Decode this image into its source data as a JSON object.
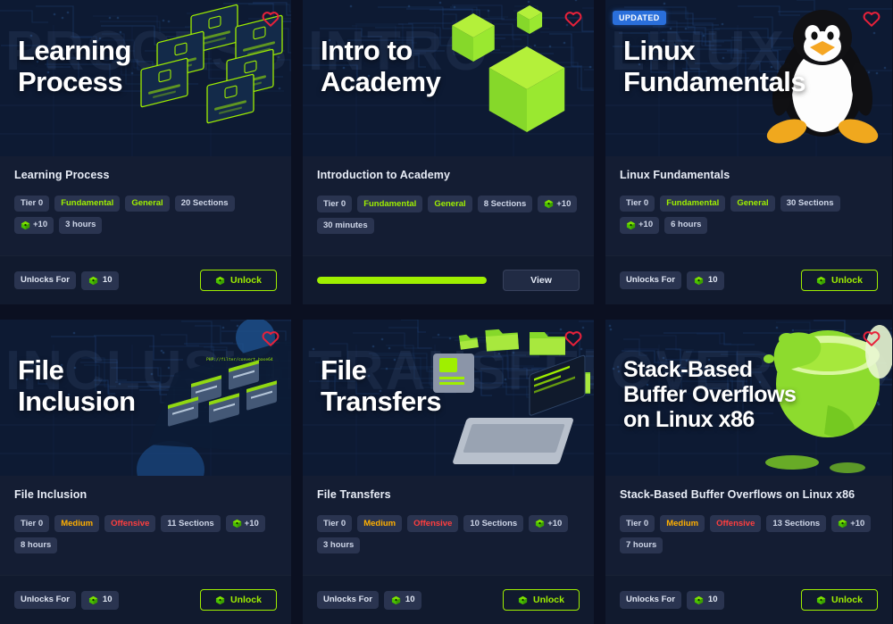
{
  "cards": [
    {
      "hero_title": "Learning\nProcess",
      "ghost": "PROCESS",
      "name": "Learning Process",
      "tags": [
        {
          "label": "Tier 0",
          "style": "default"
        },
        {
          "label": "Fundamental",
          "style": "green"
        },
        {
          "label": "General",
          "style": "green"
        },
        {
          "label": "20 Sections",
          "style": "default"
        },
        {
          "label": "+10",
          "style": "cube"
        },
        {
          "label": "3 hours",
          "style": "default"
        }
      ],
      "favorite_icon": "heart-icon",
      "footer": {
        "type": "unlock",
        "unlocks_for_label": "Unlocks For",
        "cost": "10",
        "button_label": "Unlock"
      },
      "art": "learning-process-nodes"
    },
    {
      "hero_title": "Intro to\nAcademy",
      "ghost": "INTRO",
      "name": "Introduction to Academy",
      "tags": [
        {
          "label": "Tier 0",
          "style": "default"
        },
        {
          "label": "Fundamental",
          "style": "green"
        },
        {
          "label": "General",
          "style": "green"
        },
        {
          "label": "8 Sections",
          "style": "default"
        },
        {
          "label": "+10",
          "style": "cube"
        },
        {
          "label": "30 minutes",
          "style": "default"
        }
      ],
      "favorite_icon": "heart-icon",
      "footer": {
        "type": "progress",
        "progress_percent": 100,
        "button_label": "View"
      },
      "art": "green-cubes"
    },
    {
      "badge": "UPDATED",
      "hero_title": "Linux\nFundamentals",
      "ghost": "LINUX",
      "name": "Linux Fundamentals",
      "tags": [
        {
          "label": "Tier 0",
          "style": "default"
        },
        {
          "label": "Fundamental",
          "style": "green"
        },
        {
          "label": "General",
          "style": "green"
        },
        {
          "label": "30 Sections",
          "style": "default"
        },
        {
          "label": "+10",
          "style": "cube"
        },
        {
          "label": "6 hours",
          "style": "default"
        }
      ],
      "favorite_icon": "heart-icon",
      "footer": {
        "type": "unlock",
        "unlocks_for_label": "Unlocks For",
        "cost": "10",
        "button_label": "Unlock"
      },
      "art": "tux-penguin"
    },
    {
      "hero_title": "File\nInclusion",
      "ghost": "INCLUSION",
      "name": "File Inclusion",
      "tags": [
        {
          "label": "Tier 0",
          "style": "default"
        },
        {
          "label": "Medium",
          "style": "orange"
        },
        {
          "label": "Offensive",
          "style": "red"
        },
        {
          "label": "11 Sections",
          "style": "default"
        },
        {
          "label": "+10",
          "style": "cube"
        },
        {
          "label": "8 hours",
          "style": "default"
        }
      ],
      "favorite_icon": "heart-icon",
      "footer": {
        "type": "unlock",
        "unlocks_for_label": "Unlocks For",
        "cost": "10",
        "button_label": "Unlock"
      },
      "art": "file-inclusion-diagram"
    },
    {
      "hero_title": "File\nTransfers",
      "ghost": "TRANSFER",
      "name": "File Transfers",
      "tags": [
        {
          "label": "Tier 0",
          "style": "default"
        },
        {
          "label": "Medium",
          "style": "orange"
        },
        {
          "label": "Offensive",
          "style": "red"
        },
        {
          "label": "10 Sections",
          "style": "default"
        },
        {
          "label": "+10",
          "style": "cube"
        },
        {
          "label": "3 hours",
          "style": "default"
        }
      ],
      "favorite_icon": "heart-icon",
      "footer": {
        "type": "unlock",
        "unlocks_for_label": "Unlocks For",
        "cost": "10",
        "button_label": "Unlock"
      },
      "art": "folders-laptop"
    },
    {
      "hero_title": "Stack-Based\nBuffer Overflows\non Linux x86",
      "ghost": "OVERFLOW",
      "name": "Stack-Based Buffer Overflows on Linux x86",
      "tags": [
        {
          "label": "Tier 0",
          "style": "default"
        },
        {
          "label": "Medium",
          "style": "orange"
        },
        {
          "label": "Offensive",
          "style": "red"
        },
        {
          "label": "13 Sections",
          "style": "default"
        },
        {
          "label": "+10",
          "style": "cube"
        },
        {
          "label": "7 hours",
          "style": "default"
        }
      ],
      "favorite_icon": "heart-icon",
      "footer": {
        "type": "unlock",
        "unlocks_for_label": "Unlocks For",
        "cost": "10",
        "button_label": "Unlock"
      },
      "art": "overflowing-cup"
    }
  ],
  "colors": {
    "accent_green": "#9fef00",
    "warning_orange": "#ffaf00",
    "danger_red": "#ff3e3e",
    "badge_blue": "#2a6fdb",
    "heart_red": "#e8213a",
    "card_bg": "#141d33",
    "footer_bg": "#111a2e",
    "tag_bg": "#2a3450"
  }
}
